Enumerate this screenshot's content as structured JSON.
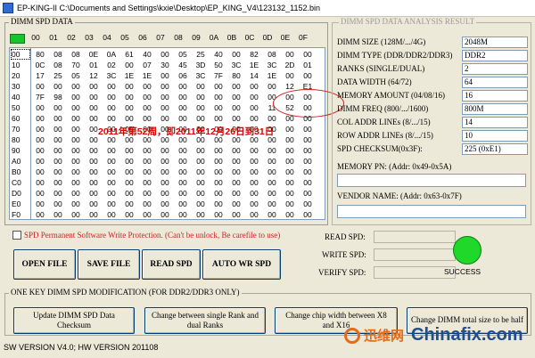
{
  "window": {
    "title": "EP-KING-II  C:\\Documents and Settings\\kxie\\Desktop\\EP_KING_V4\\123132_1152.bin"
  },
  "spd_grid": {
    "title": "DIMM SPD DATA",
    "columns": [
      "00",
      "01",
      "02",
      "03",
      "04",
      "05",
      "06",
      "07",
      "08",
      "09",
      "0A",
      "0B",
      "0C",
      "0D",
      "0E",
      "0F"
    ],
    "rows": [
      {
        "label": "00",
        "cells": [
          "80",
          "08",
          "08",
          "0E",
          "0A",
          "61",
          "40",
          "00",
          "05",
          "25",
          "40",
          "00",
          "82",
          "08",
          "00",
          "00"
        ]
      },
      {
        "label": "10",
        "cells": [
          "0C",
          "08",
          "70",
          "01",
          "02",
          "00",
          "07",
          "30",
          "45",
          "3D",
          "50",
          "3C",
          "1E",
          "3C",
          "2D",
          "01"
        ]
      },
      {
        "label": "20",
        "cells": [
          "17",
          "25",
          "05",
          "12",
          "3C",
          "1E",
          "1E",
          "00",
          "06",
          "3C",
          "7F",
          "80",
          "14",
          "1E",
          "00",
          "00"
        ]
      },
      {
        "label": "30",
        "cells": [
          "00",
          "00",
          "00",
          "00",
          "00",
          "00",
          "00",
          "00",
          "00",
          "00",
          "00",
          "00",
          "00",
          "00",
          "12",
          "E1"
        ]
      },
      {
        "label": "40",
        "cells": [
          "7F",
          "98",
          "00",
          "00",
          "00",
          "00",
          "00",
          "00",
          "00",
          "00",
          "00",
          "00",
          "00",
          "00",
          "00",
          "00"
        ]
      },
      {
        "label": "50",
        "cells": [
          "00",
          "00",
          "00",
          "00",
          "00",
          "00",
          "00",
          "00",
          "00",
          "00",
          "00",
          "00",
          "00",
          "11",
          "52",
          "00"
        ]
      },
      {
        "label": "60",
        "cells": [
          "00",
          "00",
          "00",
          "00",
          "00",
          "00",
          "00",
          "00",
          "00",
          "00",
          "00",
          "00",
          "00",
          "00",
          "00",
          "00"
        ]
      },
      {
        "label": "70",
        "cells": [
          "00",
          "00",
          "00",
          "00",
          "00",
          "00",
          "00",
          "00",
          "00",
          "00",
          "00",
          "00",
          "00",
          "00",
          "00",
          "00"
        ]
      },
      {
        "label": "80",
        "cells": [
          "00",
          "00",
          "00",
          "00",
          "00",
          "00",
          "00",
          "00",
          "00",
          "00",
          "00",
          "00",
          "00",
          "00",
          "00",
          "00"
        ]
      },
      {
        "label": "90",
        "cells": [
          "00",
          "00",
          "00",
          "00",
          "00",
          "00",
          "00",
          "00",
          "00",
          "00",
          "00",
          "00",
          "00",
          "00",
          "00",
          "00"
        ]
      },
      {
        "label": "A0",
        "cells": [
          "00",
          "00",
          "00",
          "00",
          "00",
          "00",
          "00",
          "00",
          "00",
          "00",
          "00",
          "00",
          "00",
          "00",
          "00",
          "00"
        ]
      },
      {
        "label": "B0",
        "cells": [
          "00",
          "00",
          "00",
          "00",
          "00",
          "00",
          "00",
          "00",
          "00",
          "00",
          "00",
          "00",
          "00",
          "00",
          "00",
          "00"
        ]
      },
      {
        "label": "C0",
        "cells": [
          "00",
          "00",
          "00",
          "00",
          "00",
          "00",
          "00",
          "00",
          "00",
          "00",
          "00",
          "00",
          "00",
          "00",
          "00",
          "00"
        ]
      },
      {
        "label": "D0",
        "cells": [
          "00",
          "00",
          "00",
          "00",
          "00",
          "00",
          "00",
          "00",
          "00",
          "00",
          "00",
          "00",
          "00",
          "00",
          "00",
          "00"
        ]
      },
      {
        "label": "E0",
        "cells": [
          "00",
          "00",
          "00",
          "00",
          "00",
          "00",
          "00",
          "00",
          "00",
          "00",
          "00",
          "00",
          "00",
          "00",
          "00",
          "00"
        ]
      },
      {
        "label": "F0",
        "cells": [
          "00",
          "00",
          "00",
          "00",
          "00",
          "00",
          "00",
          "00",
          "00",
          "00",
          "00",
          "00",
          "00",
          "00",
          "00",
          "00"
        ]
      }
    ],
    "annotation": "2011年第52周，即2011年12月26日到31日"
  },
  "analysis": {
    "title": "DIMM SPD DATA ANALYSIS RESULT",
    "fields": [
      {
        "label": "DIMM SIZE (128M/.../4G)",
        "value": "2048M"
      },
      {
        "label": "DIMM TYPE (DDR/DDR2/DDR3)",
        "value": "DDR2"
      },
      {
        "label": "RANKS (SINGLE/DUAL)",
        "value": "2"
      },
      {
        "label": "DATA WIDTH (64/72)",
        "value": "64"
      },
      {
        "label": "MEMORY AMOUNT (04/08/16)",
        "value": "16"
      },
      {
        "label": "DIMM FREQ (800/.../1600)",
        "value": "800M"
      },
      {
        "label": "COL ADDR LINEs (8/.../15)",
        "value": "14"
      },
      {
        "label": "ROW ADDR LINEs (8/.../15)",
        "value": "10"
      },
      {
        "label": "SPD CHECKSUM(0x3F):",
        "value": "225 (0xE1)"
      }
    ],
    "memory_pn_label": "MEMORY PN: (Addr: 0x49-0x5A)",
    "vendor_name_label": "VENDOR NAME: (Addr: 0x63-0x7F)"
  },
  "protection": {
    "label": "SPD Permanent Software Write Protection. (Can't be unlock, Be carefile to use)"
  },
  "buttons": {
    "open_file": "OPEN FILE",
    "save_file": "SAVE FILE",
    "read_spd": "READ SPD",
    "auto_wr_spd": "AUTO WR SPD"
  },
  "rw_status": {
    "read_label": "READ  SPD:",
    "write_label": "WRITE SPD:",
    "verify_label": "VERIFY SPD:",
    "success_label": "SUCCESS",
    "success_color": "#20d82a"
  },
  "one_key": {
    "title": "ONE KEY DIMM SPD MODIFICATION (FOR DDR2/DDR3 ONLY)",
    "buttons": [
      "Update DIMM SPD Data Checksum",
      "Change between single Rank and dual Ranks",
      "Change chip width between X8 and X16",
      "Change DIMM total size to be half"
    ]
  },
  "status_bar": {
    "text": "SW VERSION V4.0; HW VERSION 201108"
  },
  "watermark": {
    "cn": "迅维网",
    "en": "Chinafix.com"
  }
}
